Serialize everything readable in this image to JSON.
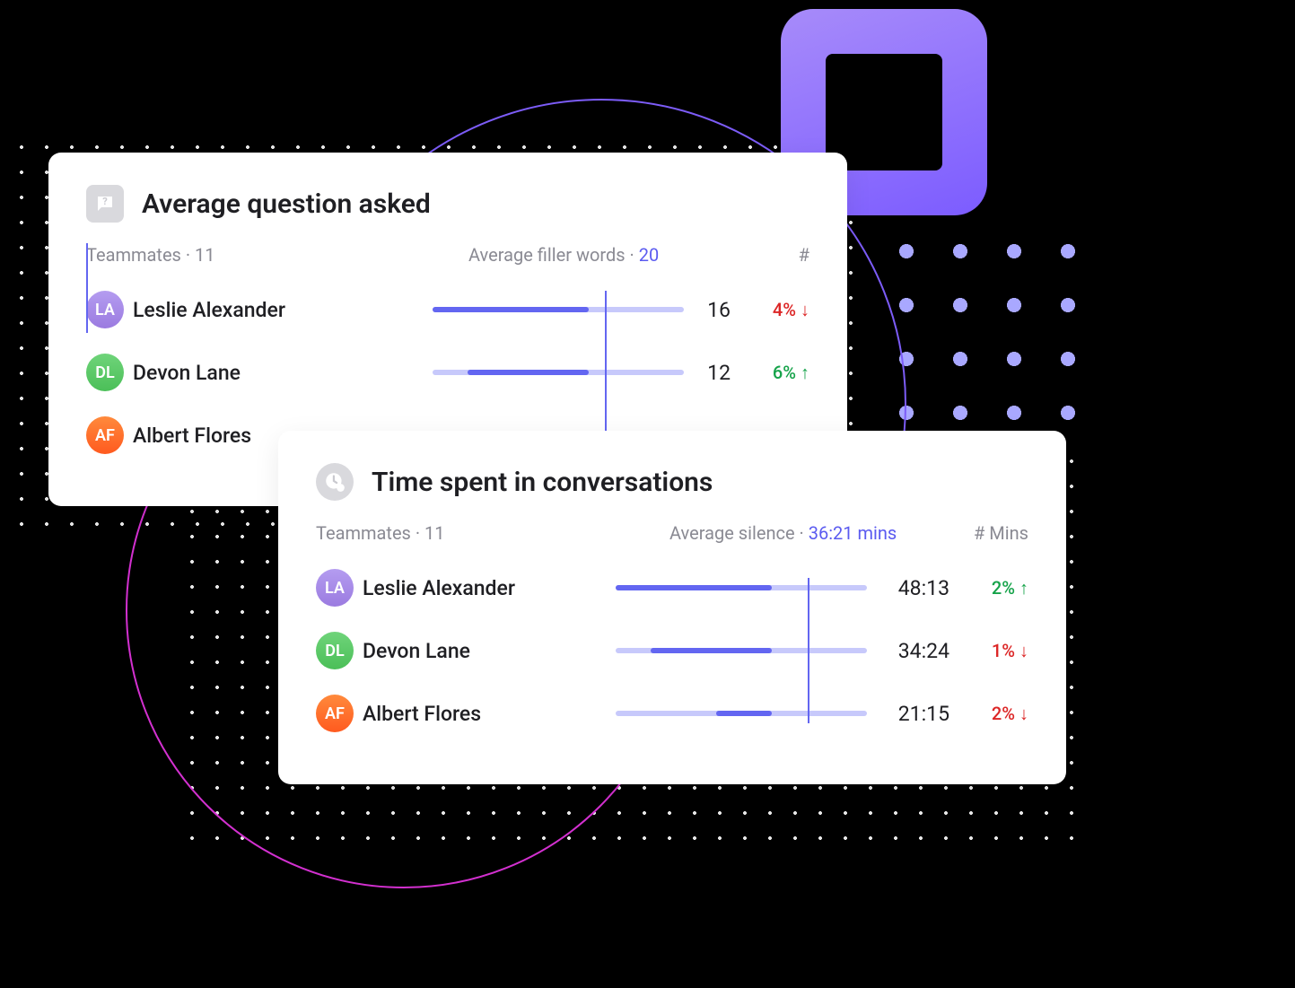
{
  "card1": {
    "title": "Average question asked",
    "teammates_label": "Teammates",
    "teammates_count": "11",
    "metric_label": "Average filler words",
    "metric_value": "20",
    "value_header": "#",
    "rows": [
      {
        "name": "Leslie Alexander",
        "value": "16",
        "delta": "4%",
        "dir": "down",
        "fill": 62
      },
      {
        "name": "Devon Lane",
        "value": "12",
        "delta": "6%",
        "dir": "up",
        "fill": 48
      },
      {
        "name": "Albert Flores",
        "value": "",
        "delta": "",
        "dir": "",
        "fill": 0
      }
    ],
    "marker": 62
  },
  "card2": {
    "title": "Time spent in conversations",
    "teammates_label": "Teammates",
    "teammates_count": "11",
    "metric_label": "Average silence",
    "metric_value": "36:21 mins",
    "value_header": "# Mins",
    "rows": [
      {
        "name": "Leslie Alexander",
        "value": "48:13",
        "delta": "2%",
        "dir": "up",
        "fill": 62
      },
      {
        "name": "Devon Lane",
        "value": "34:24",
        "delta": "1%",
        "dir": "down",
        "fill": 48
      },
      {
        "name": "Albert Flores",
        "value": "21:15",
        "delta": "2%",
        "dir": "down",
        "fill": 22
      }
    ],
    "marker": 62
  },
  "avatars": [
    "LA",
    "DL",
    "AF"
  ]
}
